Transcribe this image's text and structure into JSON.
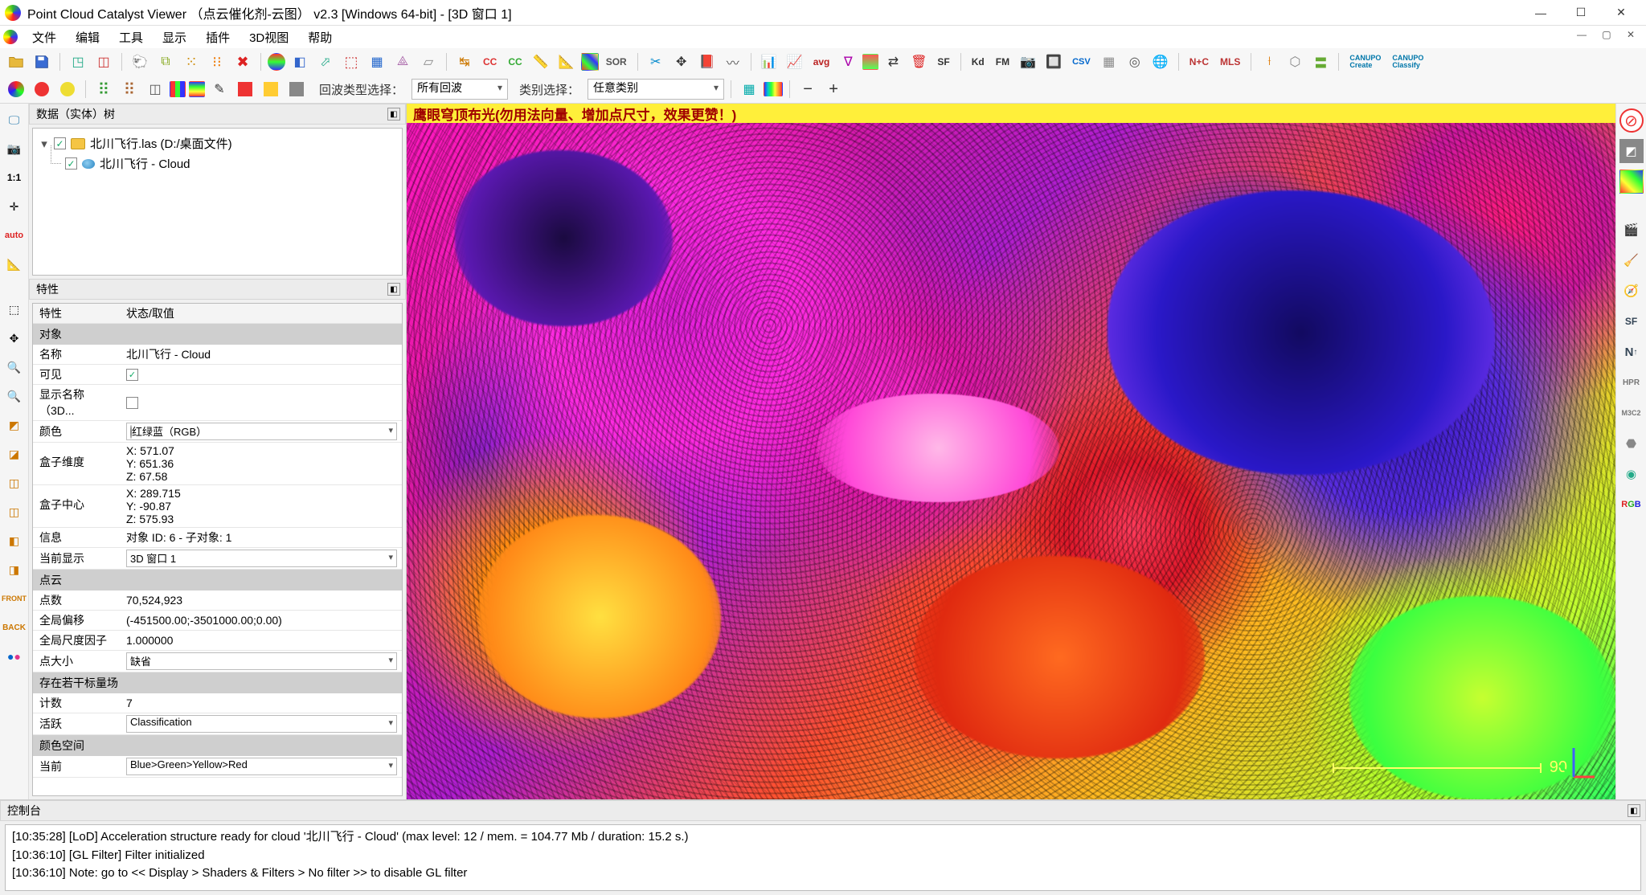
{
  "title": "Point Cloud Catalyst Viewer  （点云催化剂-云图）  v2.3  [Windows 64-bit] - [3D 窗口 1]",
  "menu": [
    "文件",
    "编辑",
    "工具",
    "显示",
    "插件",
    "3D视图",
    "帮助"
  ],
  "row2": {
    "returnTypeLabel": "回波类型选择：",
    "returnTypeValue": "所有回波",
    "classSelectLabel": "类别选择：",
    "classSelectValue": "任意类别"
  },
  "docks": {
    "dbtree": "数据（实体）树",
    "props": "特性",
    "console": "控制台"
  },
  "tree": {
    "root": {
      "label": "北川飞行.las (D:/桌面文件)",
      "checked": true
    },
    "child": {
      "label": "北川飞行 - Cloud",
      "checked": true
    }
  },
  "propHeader": {
    "k": "特性",
    "v": "状态/取值"
  },
  "sections": {
    "object": "对象",
    "pointcloud": "点云",
    "sfields": "存在若干标量场",
    "colorspace": "颜色空间"
  },
  "props": {
    "name_k": "名称",
    "name_v": "北川飞行 - Cloud",
    "visible_k": "可见",
    "showname_k": "显示名称（3D...",
    "color_k": "颜色",
    "color_v": "红绿蓝（RGB）",
    "boxdim_k": "盒子维度",
    "boxdim_x": "X: 571.07",
    "boxdim_y": "Y: 651.36",
    "boxdim_z": "Z: 67.58",
    "boxctr_k": "盒子中心",
    "boxctr_x": "X: 289.715",
    "boxctr_y": "Y: -90.87",
    "boxctr_z": "Z: 575.93",
    "info_k": "信息",
    "info_v": "对象 ID: 6 - 子对象: 1",
    "curdisp_k": "当前显示",
    "curdisp_v": "3D 窗口 1",
    "pcount_k": "点数",
    "pcount_v": "70,524,923",
    "gshift_k": "全局偏移",
    "gshift_v": "(-451500.00;-3501000.00;0.00)",
    "gscale_k": "全局尺度因子",
    "gscale_v": "1.000000",
    "psize_k": "点大小",
    "psize_v": "缺省",
    "sfcount_k": "计数",
    "sfcount_v": "7",
    "active_k": "活跃",
    "active_v": "Classification",
    "curramp_k": "当前",
    "curramp_v": "Blue>Green>Yellow>Red"
  },
  "overlay": "鹰眼穹顶布光(勿用法向量、增加点尺寸，效果更赞！)",
  "scalebar": "90",
  "console": [
    "[10:35:28] [LoD] Acceleration structure ready for cloud '北川飞行 - Cloud' (max level: 12 / mem. = 104.77 Mb / duration: 15.2 s.)",
    "[10:36:10] [GL Filter] Filter initialized",
    "[10:36:10] Note: go to << Display > Shaders & Filters > No filter >> to disable GL filter"
  ]
}
